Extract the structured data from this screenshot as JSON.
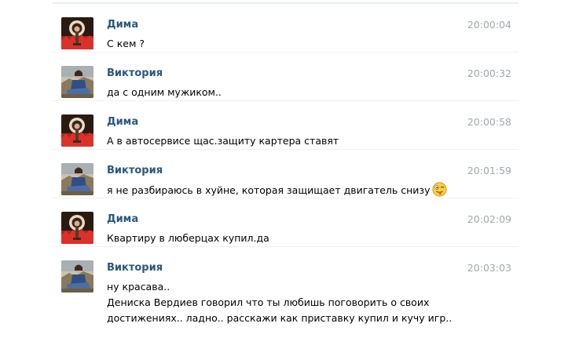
{
  "messages": [
    {
      "author": "Дима",
      "time": "20:00:04",
      "avatar": "dima-avatar",
      "lines": [
        "С кем ?"
      ]
    },
    {
      "author": "Виктория",
      "time": "20:00:32",
      "avatar": "viktoria-avatar",
      "lines": [
        "да с одним мужиком.."
      ]
    },
    {
      "author": "Дима",
      "time": "20:00:58",
      "avatar": "dima-avatar",
      "lines": [
        "А в автосервисе щас.защиту картера ставят"
      ]
    },
    {
      "author": "Виктория",
      "time": "20:01:59",
      "avatar": "viktoria-avatar",
      "lines": [
        "я не разбираюсь в хуйне, которая защищает двигатель снизу"
      ],
      "emoji": "tongue-wink-emoji"
    },
    {
      "author": "Дима",
      "time": "20:02:09",
      "avatar": "dima-avatar",
      "lines": [
        "Квартиру в люберцах купил.да"
      ]
    },
    {
      "author": "Виктория",
      "time": "20:03:03",
      "avatar": "viktoria-avatar",
      "lines": [
        "ну красава..",
        "Дениска Вердиев говорил что ты любишь поговорить о своих",
        "достижениях.. ладно.. расскажи как приставку купил и кучу игр.."
      ]
    }
  ],
  "colors": {
    "author_name": "#2b587a",
    "timestamp": "#a0a6ae",
    "message_text": "#000000",
    "divider": "#eef1f4"
  }
}
